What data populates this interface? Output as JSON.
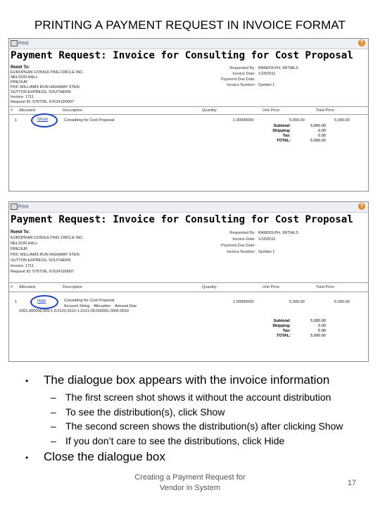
{
  "slide": {
    "title": "PRINTING A PAYMENT REQUEST IN INVOICE FORMAT",
    "footer_line1": "Creating a Payment Request for",
    "footer_line2": "Vendor in System",
    "page_number": "17"
  },
  "screenshot1": {
    "print_label": "Print",
    "doc_title": "Payment Request: Invoice for Consulting for Cost Proposal",
    "remit_label": "Remit To:",
    "remit_lines": [
      "EUROPEAN CONSULTING CIRCLE INC.",
      "NELSON HALL",
      "PREOUR",
      "PDC WILLIAMS RUN HIGHWAY STEN",
      "SUTTON EXPRESS, SOUTHERN",
      "Invoice: 1711",
      "Request ID: 576TOE, 676241D0007"
    ],
    "meta": [
      {
        "k": "Requested By:",
        "v": "RANDOLPH, INITIALS"
      },
      {
        "k": "Invoice Date:",
        "v": "1/10/2011"
      },
      {
        "k": "Payment Due Date:",
        "v": ""
      },
      {
        "k": "Invoice Number:",
        "v": "Symbol 1"
      }
    ],
    "columns": [
      "#",
      "Allocated",
      "Description",
      "Quantity",
      "Unit Price",
      "Total Price"
    ],
    "row": {
      "num": "1",
      "link": "Show",
      "desc": "Consulting for Cost Proposal",
      "qty": "1.00000000",
      "unit": "5,000.00",
      "total": "5,000.00"
    },
    "totals": [
      {
        "k": "Subtotal:",
        "v": "5,000.00"
      },
      {
        "k": "Shipping:",
        "v": "0.00"
      },
      {
        "k": "Tax:",
        "v": "0.00"
      },
      {
        "k": "TOTAL:",
        "v": "5,000.00"
      }
    ]
  },
  "screenshot2": {
    "print_label": "Print",
    "doc_title": "Payment Request: Invoice for Consulting for Cost Proposal",
    "remit_label": "Remit To:",
    "remit_lines": [
      "EUROPEAN CONSULTING CIRCLE INC.",
      "NELSON HALL",
      "PREOUR",
      "PDC WILLIAMS RUN HIGHWAY STEN",
      "SUTTON EXPRESS, SOUTHERN",
      "Invoice: 1711",
      "Request ID: 576TOE, 676241D0007"
    ],
    "meta": [
      {
        "k": "Requested By:",
        "v": "RANDOLPH, INITIALS"
      },
      {
        "k": "Invoice Date:",
        "v": "1/10/2011"
      },
      {
        "k": "Payment Due Date:",
        "v": ""
      },
      {
        "k": "Invoice Number:",
        "v": "Symbol 1"
      }
    ],
    "columns": [
      "#",
      "Allocated",
      "Description",
      "Quantity",
      "Unit Price",
      "Total Price"
    ],
    "row": {
      "num": "1",
      "link": "Hide",
      "desc": "Consulting for Cost Proposal",
      "qty": "1.00000000",
      "unit": "5,000.00",
      "total": "5,000.00"
    },
    "dist_headers": [
      "Account String",
      "Allocation",
      "Amount Due"
    ],
    "dist_row": "1001.000000.000.1.0.0101-0110-1.3101-00.000001.0000.0010",
    "totals": [
      {
        "k": "Subtotal:",
        "v": "5,000.00"
      },
      {
        "k": "Shipping:",
        "v": "0.00"
      },
      {
        "k": "Tax:",
        "v": "0.00"
      },
      {
        "k": "TOTAL:",
        "v": "5,000.00"
      }
    ]
  },
  "bullets": {
    "main1": "The dialogue box appears with the invoice information",
    "subs": [
      "The first screen shot shows it without the account distribution",
      "To see the distribution(s), click Show",
      "The second screen shows the distribution(s) after clicking Show",
      "If you don’t care to see the distributions, click Hide"
    ],
    "main2": "Close the dialogue box"
  }
}
